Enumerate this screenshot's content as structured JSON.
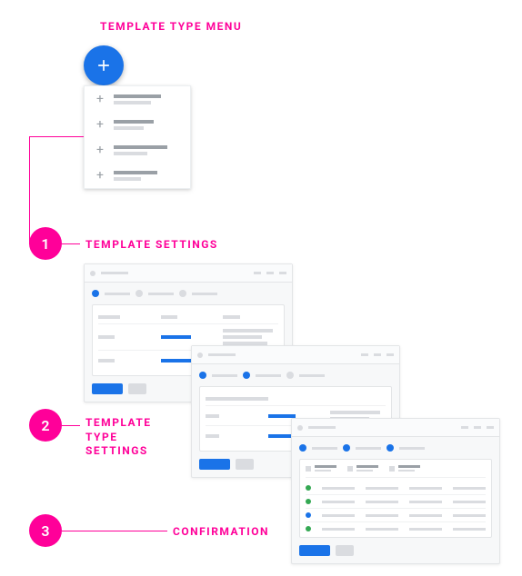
{
  "title_label": "TEMPLATE TYPE MENU",
  "steps": [
    {
      "number": "1",
      "label": "TEMPLATE SETTINGS"
    },
    {
      "number": "2",
      "label": "TEMPLATE\nTYPE\nSETTINGS"
    },
    {
      "number": "3",
      "label": "CONFIRMATION"
    }
  ],
  "fab_icon": "plus-icon",
  "colors": {
    "accent": "#ff0099",
    "primary": "#1a73e8",
    "success": "#34a853",
    "skeleton": "#dadce0",
    "skeleton_dark": "#9aa0a6"
  }
}
